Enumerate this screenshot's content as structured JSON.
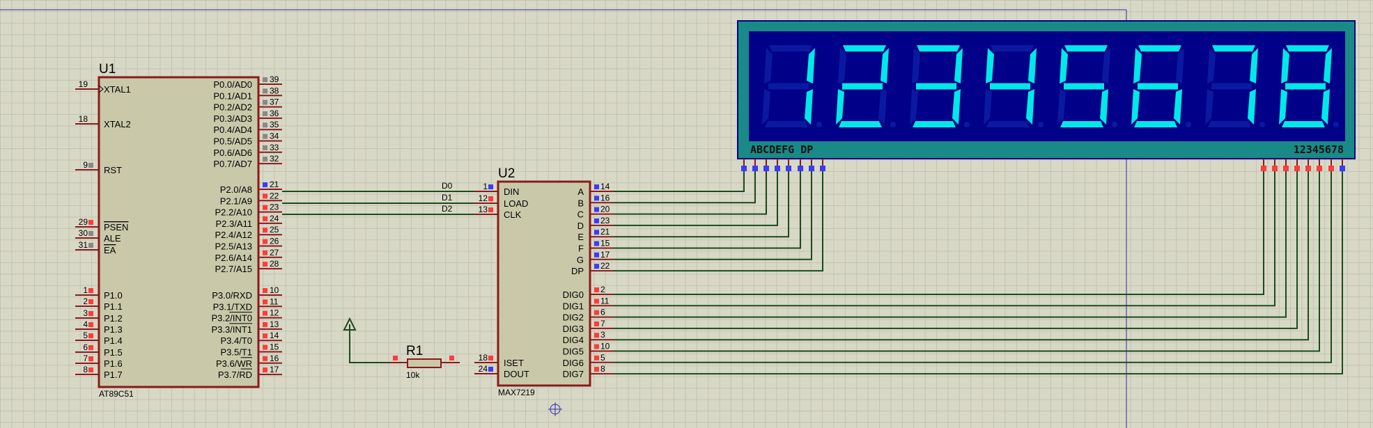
{
  "colors": {
    "background": "#d8d8c6",
    "chip_fill": "#c9c9aa",
    "chip_border": "#8b1a1a",
    "wire": "#1c4a1c",
    "display_frame": "#1a8a88",
    "display_bg": "#000088",
    "segment_on": "#00e8e8",
    "segment_off": "#0a1aa0",
    "pin_input": "#3b3bff",
    "pin_output": "#ff3b3b",
    "pin_passive": "#888888"
  },
  "u1": {
    "ref": "U1",
    "part": "AT89C51",
    "left_pins": [
      {
        "num": "19",
        "label": "XTAL1",
        "marker": "clock"
      },
      {
        "num": "18",
        "label": "XTAL2",
        "marker": ""
      },
      {
        "num": "9",
        "label": "RST",
        "marker": "passive"
      },
      {
        "num": "29",
        "label": "PSEN",
        "marker": "output",
        "overline": true
      },
      {
        "num": "30",
        "label": "ALE",
        "marker": "passive"
      },
      {
        "num": "31",
        "label": "EA",
        "marker": "passive",
        "overline": true
      },
      {
        "num": "1",
        "label": "P1.0",
        "marker": "output"
      },
      {
        "num": "2",
        "label": "P1.1",
        "marker": "output"
      },
      {
        "num": "3",
        "label": "P1.2",
        "marker": "output"
      },
      {
        "num": "4",
        "label": "P1.3",
        "marker": "output"
      },
      {
        "num": "5",
        "label": "P1.4",
        "marker": "output"
      },
      {
        "num": "6",
        "label": "P1.5",
        "marker": "output"
      },
      {
        "num": "7",
        "label": "P1.6",
        "marker": "output"
      },
      {
        "num": "8",
        "label": "P1.7",
        "marker": "output"
      }
    ],
    "right_pins": [
      {
        "num": "39",
        "label": "P0.0/AD0",
        "marker": "passive"
      },
      {
        "num": "38",
        "label": "P0.1/AD1",
        "marker": "passive"
      },
      {
        "num": "37",
        "label": "P0.2/AD2",
        "marker": "passive"
      },
      {
        "num": "36",
        "label": "P0.3/AD3",
        "marker": "passive"
      },
      {
        "num": "35",
        "label": "P0.4/AD4",
        "marker": "passive"
      },
      {
        "num": "34",
        "label": "P0.5/AD5",
        "marker": "passive"
      },
      {
        "num": "33",
        "label": "P0.6/AD6",
        "marker": "passive"
      },
      {
        "num": "32",
        "label": "P0.7/AD7",
        "marker": "passive"
      },
      {
        "num": "21",
        "label": "P2.0/A8",
        "marker": "input"
      },
      {
        "num": "22",
        "label": "P2.1/A9",
        "marker": "output"
      },
      {
        "num": "23",
        "label": "P2.2/A10",
        "marker": "output"
      },
      {
        "num": "24",
        "label": "P2.3/A11",
        "marker": "output"
      },
      {
        "num": "25",
        "label": "P2.4/A12",
        "marker": "output"
      },
      {
        "num": "26",
        "label": "P2.5/A13",
        "marker": "output"
      },
      {
        "num": "27",
        "label": "P2.6/A14",
        "marker": "output"
      },
      {
        "num": "28",
        "label": "P2.7/A15",
        "marker": "output"
      },
      {
        "num": "10",
        "label": "P3.0/RXD",
        "marker": "output"
      },
      {
        "num": "11",
        "label": "P3.1/TXD",
        "marker": "output"
      },
      {
        "num": "12",
        "label": "P3.2/INT0",
        "marker": "output",
        "overline_part": "INT0"
      },
      {
        "num": "13",
        "label": "P3.3/INT1",
        "marker": "output",
        "overline_part": "INT1"
      },
      {
        "num": "14",
        "label": "P3.4/T0",
        "marker": "output"
      },
      {
        "num": "15",
        "label": "P3.5/T1",
        "marker": "output"
      },
      {
        "num": "16",
        "label": "P3.6/WR",
        "marker": "output",
        "overline_part": "WR"
      },
      {
        "num": "17",
        "label": "P3.7/RD",
        "marker": "output",
        "overline_part": "RD"
      }
    ]
  },
  "u2": {
    "ref": "U2",
    "part": "MAX7219",
    "left_pins": [
      {
        "num": "1",
        "label": "DIN",
        "marker": "input",
        "net": "D0"
      },
      {
        "num": "12",
        "label": "LOAD",
        "marker": "output",
        "net": "D1"
      },
      {
        "num": "13",
        "label": "CLK",
        "marker": "output",
        "net": "D2"
      },
      {
        "num": "18",
        "label": "ISET",
        "marker": "output",
        "net": ""
      },
      {
        "num": "24",
        "label": "DOUT",
        "marker": "input",
        "net": ""
      }
    ],
    "right_pins": [
      {
        "num": "14",
        "label": "A",
        "marker": "input"
      },
      {
        "num": "16",
        "label": "B",
        "marker": "input"
      },
      {
        "num": "20",
        "label": "C",
        "marker": "input"
      },
      {
        "num": "23",
        "label": "D",
        "marker": "input"
      },
      {
        "num": "21",
        "label": "E",
        "marker": "input"
      },
      {
        "num": "15",
        "label": "F",
        "marker": "input"
      },
      {
        "num": "17",
        "label": "G",
        "marker": "input"
      },
      {
        "num": "22",
        "label": "DP",
        "marker": "input"
      },
      {
        "num": "2",
        "label": "DIG0",
        "marker": "output"
      },
      {
        "num": "11",
        "label": "DIG1",
        "marker": "output"
      },
      {
        "num": "6",
        "label": "DIG2",
        "marker": "output"
      },
      {
        "num": "7",
        "label": "DIG3",
        "marker": "output"
      },
      {
        "num": "3",
        "label": "DIG4",
        "marker": "output"
      },
      {
        "num": "10",
        "label": "DIG5",
        "marker": "output"
      },
      {
        "num": "5",
        "label": "DIG6",
        "marker": "output"
      },
      {
        "num": "8",
        "label": "DIG7",
        "marker": "output"
      }
    ]
  },
  "r1": {
    "ref": "R1",
    "value": "10k"
  },
  "display": {
    "digits": [
      "1",
      "2",
      "3",
      "4",
      "5",
      "6",
      "7",
      "8"
    ],
    "segment_label": "ABCDEFG DP",
    "digit_label": "12345678"
  }
}
